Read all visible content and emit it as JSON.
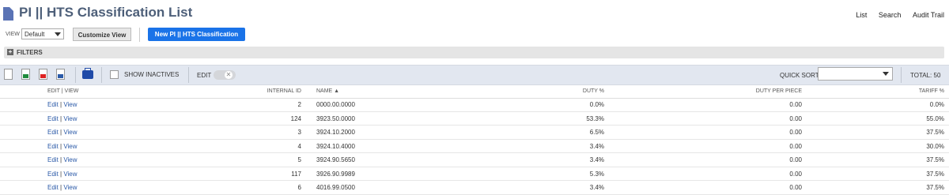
{
  "header": {
    "title": "PI || HTS Classification List",
    "links": [
      "List",
      "Search",
      "Audit Trail"
    ]
  },
  "view": {
    "label": "VIEW",
    "selected": "Default",
    "customize_label": "Customize View",
    "new_label": "New PI || HTS Classification"
  },
  "filters": {
    "label": "FILTERS"
  },
  "toolbar": {
    "show_inactives": "SHOW INACTIVES",
    "edit_label": "EDIT",
    "quick_sort_label": "QUICK SORT",
    "total": "TOTAL: 50"
  },
  "table": {
    "headers": {
      "edit_view": "EDIT | VIEW",
      "internal_id": "INTERNAL ID",
      "name": "NAME ▲",
      "duty": "DUTY %",
      "duty_per_piece": "DUTY PER PIECE",
      "tariff": "TARIFF %"
    },
    "edit_text": "Edit",
    "view_text": "View",
    "rows": [
      {
        "id": "2",
        "name": "0000.00.0000",
        "duty": "0.0%",
        "dpp": "0.00",
        "tariff": "0.0%"
      },
      {
        "id": "124",
        "name": "3923.50.0000",
        "duty": "53.3%",
        "dpp": "0.00",
        "tariff": "55.0%"
      },
      {
        "id": "3",
        "name": "3924.10.2000",
        "duty": "6.5%",
        "dpp": "0.00",
        "tariff": "37.5%"
      },
      {
        "id": "4",
        "name": "3924.10.4000",
        "duty": "3.4%",
        "dpp": "0.00",
        "tariff": "30.0%"
      },
      {
        "id": "5",
        "name": "3924.90.5650",
        "duty": "3.4%",
        "dpp": "0.00",
        "tariff": "37.5%"
      },
      {
        "id": "117",
        "name": "3926.90.9989",
        "duty": "5.3%",
        "dpp": "0.00",
        "tariff": "37.5%"
      },
      {
        "id": "6",
        "name": "4016.99.0500",
        "duty": "3.4%",
        "dpp": "0.00",
        "tariff": "37.5%"
      }
    ]
  }
}
